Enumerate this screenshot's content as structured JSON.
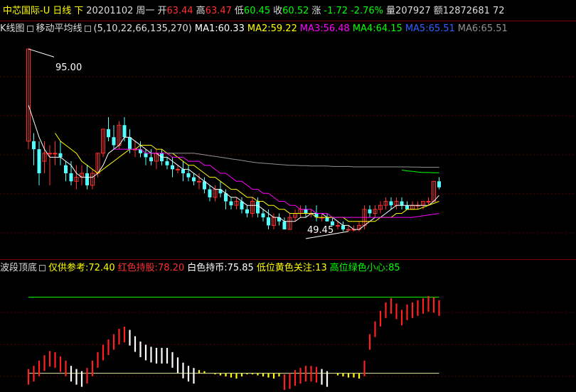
{
  "header": {
    "name": "中芯国际-U",
    "period": "日线",
    "dir": "下",
    "date": "20201102",
    "weekday": "周一",
    "open_label": "开",
    "open": "63.44",
    "high_label": "高",
    "high": "63.47",
    "low_label": "低",
    "low": "60.45",
    "close_label": "收",
    "close": "60.52",
    "chg_label": "涨",
    "chg": "-1.72",
    "chg_pct": "-2.76%",
    "vol_label": "量",
    "vol": "207927",
    "amt_label": "额",
    "amt": "12872681 72"
  },
  "ma_bar": {
    "kline_label": "K线图",
    "ma_title": "移动平均线",
    "params": "(5,10,22,66,135,270)",
    "ma1": "MA1:60.33",
    "ma2": "MA2:59.22",
    "ma3": "MA3:56.48",
    "ma4": "MA4:64.15",
    "ma5": "MA5:65.51",
    "ma6": "MA6:65.51"
  },
  "annotations": {
    "high_mark": "95.00",
    "low_mark": "49.45"
  },
  "indicator_bar": {
    "name": "波段顶底",
    "ref": "仅供参考:72.40",
    "red": "红色持股:78.20",
    "white": "白色持币:75.85",
    "yellow": "低位黄色关注:13",
    "green": "高位绿色小心:85"
  },
  "colors": {
    "up": "#ff3030",
    "down": "#54ffff",
    "ma1": "#ffffff",
    "ma2": "#ffff00",
    "ma3": "#ff00ff",
    "ma4": "#00ff00",
    "ma5": "#3060ff",
    "ma6": "#909090",
    "ind_red": "#ff2020",
    "ind_white": "#ffffff",
    "ind_yellow": "#ffff00"
  },
  "chart_data": {
    "type": "candlestick",
    "yrange": [
      47,
      98
    ],
    "candles": [
      [
        72,
        95,
        70,
        95
      ],
      [
        72,
        74,
        66,
        70
      ],
      [
        70,
        72,
        61,
        64
      ],
      [
        67,
        72,
        64,
        69
      ],
      [
        69,
        71,
        61,
        69
      ],
      [
        69,
        72,
        66,
        69
      ],
      [
        69,
        72,
        66,
        68
      ],
      [
        66,
        67,
        62,
        64
      ],
      [
        64,
        67,
        61,
        62
      ],
      [
        62,
        66,
        60,
        63
      ],
      [
        63,
        66,
        61,
        64
      ],
      [
        64,
        66,
        60,
        61
      ],
      [
        61,
        65,
        60,
        64
      ],
      [
        64,
        69,
        63,
        69
      ],
      [
        69,
        75,
        68,
        75
      ],
      [
        75,
        78,
        72,
        73
      ],
      [
        73,
        76,
        70,
        71
      ],
      [
        71,
        77,
        70,
        76
      ],
      [
        76,
        78,
        72,
        73
      ],
      [
        73,
        75,
        69,
        70
      ],
      [
        70,
        72,
        68,
        70
      ],
      [
        70,
        72,
        68,
        69
      ],
      [
        69,
        70,
        66,
        68
      ],
      [
        68,
        70,
        66,
        67
      ],
      [
        67,
        70,
        65,
        69
      ],
      [
        69,
        70,
        66,
        67
      ],
      [
        67,
        68,
        65,
        66
      ],
      [
        66,
        68,
        63,
        65
      ],
      [
        65,
        66,
        64,
        65
      ],
      [
        65,
        67,
        62,
        64
      ],
      [
        64,
        66,
        62,
        63
      ],
      [
        63,
        64,
        61,
        62
      ],
      [
        62,
        64,
        60,
        62
      ],
      [
        62,
        63,
        59,
        60
      ],
      [
        60,
        61,
        57,
        58
      ],
      [
        58,
        61,
        57,
        60
      ],
      [
        60,
        62,
        58,
        59
      ],
      [
        59,
        60,
        55,
        57
      ],
      [
        57,
        58,
        55,
        56
      ],
      [
        56,
        58,
        55,
        57
      ],
      [
        57,
        58,
        54,
        55
      ],
      [
        55,
        56,
        53,
        54
      ],
      [
        54,
        58,
        53,
        57
      ],
      [
        57,
        58,
        53,
        54
      ],
      [
        54,
        55,
        52,
        53
      ],
      [
        53,
        55,
        50,
        51
      ],
      [
        51,
        54,
        50,
        53
      ],
      [
        53,
        54,
        51,
        52
      ],
      [
        52,
        53,
        50,
        50
      ],
      [
        50,
        54,
        50,
        53
      ],
      [
        53,
        55,
        52,
        54
      ],
      [
        54,
        56,
        53,
        55
      ],
      [
        55,
        56,
        53,
        54
      ],
      [
        54,
        55,
        53,
        54
      ],
      [
        54,
        56,
        52,
        53
      ],
      [
        53,
        54,
        52,
        53
      ],
      [
        53,
        54,
        52,
        52
      ],
      [
        52,
        53,
        51,
        51
      ],
      [
        51,
        52,
        50,
        51
      ],
      [
        51,
        52,
        49.5,
        50
      ],
      [
        50,
        51,
        49.5,
        50
      ],
      [
        50,
        51,
        49.5,
        50
      ],
      [
        50,
        52,
        49.5,
        51
      ],
      [
        51,
        56,
        50,
        55
      ],
      [
        55,
        56,
        53,
        54
      ],
      [
        54,
        56,
        53,
        55
      ],
      [
        55,
        57,
        54,
        56
      ],
      [
        56,
        58,
        55,
        57
      ],
      [
        57,
        58,
        55,
        56
      ],
      [
        56,
        58,
        55,
        57
      ],
      [
        57,
        58,
        55,
        56
      ],
      [
        56,
        57,
        55,
        55
      ],
      [
        55,
        57,
        55,
        56
      ],
      [
        56,
        57,
        55,
        56
      ],
      [
        56,
        57,
        55,
        57
      ],
      [
        57,
        58,
        56,
        57
      ],
      [
        57,
        62,
        57,
        62
      ],
      [
        62,
        63,
        60,
        60.5
      ]
    ],
    "ma1": [
      81,
      77,
      73,
      70,
      68,
      68,
      68,
      67,
      66,
      64,
      63,
      63,
      63,
      64,
      66,
      69,
      70,
      71,
      73,
      73,
      72,
      71,
      70,
      69,
      69,
      68,
      68,
      67,
      66,
      65,
      65,
      64,
      63,
      62,
      61,
      60,
      60,
      59,
      58,
      58,
      57,
      56,
      56,
      56,
      55,
      54,
      53,
      53,
      52,
      52,
      52,
      53,
      53,
      54,
      54,
      54,
      53,
      53,
      52,
      51,
      51,
      50,
      50,
      51,
      52,
      53,
      53,
      54,
      55,
      56,
      56,
      56,
      56,
      56,
      56,
      56,
      57,
      58.5
    ],
    "ma2": [
      null,
      null,
      null,
      null,
      null,
      74,
      72,
      71,
      70,
      69,
      67,
      66,
      65,
      64,
      65,
      66,
      67,
      68,
      69,
      70,
      70,
      71,
      71,
      71,
      70,
      70,
      69,
      69,
      68,
      67,
      66,
      66,
      65,
      64,
      63,
      63,
      62,
      61,
      60,
      60,
      59,
      58,
      58,
      57,
      57,
      56,
      56,
      55,
      55,
      54,
      54,
      54,
      54,
      54,
      53,
      53,
      53,
      53,
      53,
      53,
      52,
      52,
      52,
      52,
      52,
      52,
      53,
      53,
      53,
      54,
      54,
      55,
      55,
      55,
      55.5,
      56,
      56.5,
      57
    ],
    "ma3": [
      null,
      null,
      null,
      null,
      null,
      null,
      null,
      null,
      null,
      null,
      null,
      null,
      null,
      null,
      null,
      null,
      70,
      70,
      70,
      70,
      70,
      70,
      69,
      69,
      69,
      69,
      69,
      68,
      68,
      68,
      67,
      67,
      67,
      66,
      66,
      65,
      64,
      64,
      63,
      62,
      62,
      61,
      60,
      60,
      59,
      59,
      58,
      57,
      57,
      56,
      56,
      55,
      55,
      55,
      54,
      54,
      54,
      53,
      53,
      53,
      53,
      53,
      53,
      53,
      53,
      53,
      53,
      53,
      53,
      53,
      53,
      53,
      53,
      53.2,
      53.4,
      53.6,
      53.8,
      54
    ],
    "ma4": [
      null,
      null,
      null,
      null,
      null,
      null,
      null,
      null,
      null,
      null,
      null,
      null,
      null,
      null,
      null,
      null,
      null,
      null,
      null,
      null,
      null,
      null,
      null,
      null,
      null,
      null,
      null,
      null,
      null,
      null,
      null,
      null,
      null,
      null,
      null,
      null,
      null,
      null,
      null,
      null,
      null,
      null,
      null,
      null,
      null,
      null,
      null,
      null,
      null,
      null,
      null,
      null,
      null,
      null,
      null,
      null,
      null,
      null,
      null,
      null,
      null,
      null,
      null,
      null,
      null,
      null,
      null,
      null,
      null,
      null,
      64.8,
      64.6,
      64.5,
      64.3,
      64.2,
      64.2,
      64.15,
      64.15
    ],
    "ma6": [
      null,
      null,
      null,
      null,
      null,
      null,
      null,
      null,
      null,
      null,
      null,
      null,
      null,
      null,
      null,
      null,
      null,
      null,
      null,
      null,
      null,
      null,
      null,
      null,
      null,
      null,
      69,
      69,
      69,
      69,
      69,
      69,
      68.8,
      68.6,
      68.4,
      68.2,
      68,
      67.8,
      67.6,
      67.4,
      67.2,
      67,
      66.8,
      66.6,
      66.5,
      66.4,
      66.3,
      66.2,
      66.1,
      66,
      66,
      65.9,
      65.9,
      65.8,
      65.8,
      65.8,
      65.8,
      65.7,
      65.7,
      65.7,
      65.7,
      65.6,
      65.6,
      65.6,
      65.6,
      65.6,
      65.6,
      65.6,
      65.6,
      65.6,
      65.6,
      65.6,
      65.55,
      65.55,
      65.5,
      65.5,
      65.5,
      65.51
    ],
    "indicator": {
      "yrange": [
        0,
        100
      ],
      "baseline": 13,
      "top_line": 85,
      "values": [
        17,
        20,
        25,
        30,
        34,
        33,
        29,
        25,
        20,
        17,
        15,
        18,
        25,
        33,
        40,
        45,
        50,
        55,
        57,
        54,
        48,
        43,
        40,
        38,
        37,
        37,
        37,
        33,
        28,
        23,
        20,
        18,
        16,
        15,
        13,
        12,
        11,
        10,
        9,
        8,
        10,
        12,
        12,
        11,
        10,
        9,
        8,
        10,
        12,
        13,
        16,
        18,
        20,
        20,
        19,
        17,
        15,
        13,
        11,
        10,
        9,
        9,
        8,
        25,
        50,
        62,
        72,
        80,
        84,
        79,
        73,
        78,
        80,
        82,
        84,
        86,
        85,
        82
      ],
      "colors": [
        "r",
        "r",
        "r",
        "r",
        "r",
        "r",
        "r",
        "r",
        "w",
        "w",
        "w",
        "r",
        "r",
        "r",
        "r",
        "r",
        "r",
        "r",
        "r",
        "w",
        "w",
        "w",
        "w",
        "w",
        "w",
        "w",
        "w",
        "w",
        "w",
        "w",
        "w",
        "w",
        "y",
        "y",
        "y",
        "y",
        "y",
        "y",
        "y",
        "y",
        "y",
        "y",
        "y",
        "y",
        "y",
        "y",
        "y",
        "y",
        "r",
        "r",
        "r",
        "r",
        "r",
        "r",
        "r",
        "w",
        "w",
        "y",
        "y",
        "y",
        "y",
        "y",
        "y",
        "r",
        "r",
        "r",
        "r",
        "r",
        "r",
        "r",
        "r",
        "r",
        "r",
        "r",
        "r",
        "r",
        "r",
        "r"
      ]
    }
  }
}
